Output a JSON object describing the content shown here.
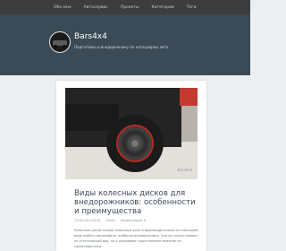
{
  "nav": {
    "items": [
      {
        "label": "Обо мне"
      },
      {
        "label": "Автосервис"
      },
      {
        "label": "Проекты"
      },
      {
        "label": "Категории"
      },
      {
        "label": "Теги"
      }
    ]
  },
  "header": {
    "site_title": "Bars4x4",
    "site_description": "Подготовка и внедорожнику по ногоциарны авто"
  },
  "post": {
    "image_watermark": "Bars4x4",
    "title": "Виды колесных дисков для внедорожников: особенности и преимущества",
    "meta": {
      "date": "13.06.2024 09:30",
      "author": "Admin",
      "comments": "Комментарии: 0"
    },
    "excerpt": "Колесные диски играют ключевую роль в производительности и внешнем виде любого автомобиля, особенно внедорожника. Они не только влияют на эстетический вид, но и оказывают существенное влияние на характеристики"
  },
  "colors": {
    "topbar": "#3d3d3d",
    "hero": "#3a4a56",
    "page_bg": "#eceff1",
    "title_text": "#3f4a55"
  }
}
